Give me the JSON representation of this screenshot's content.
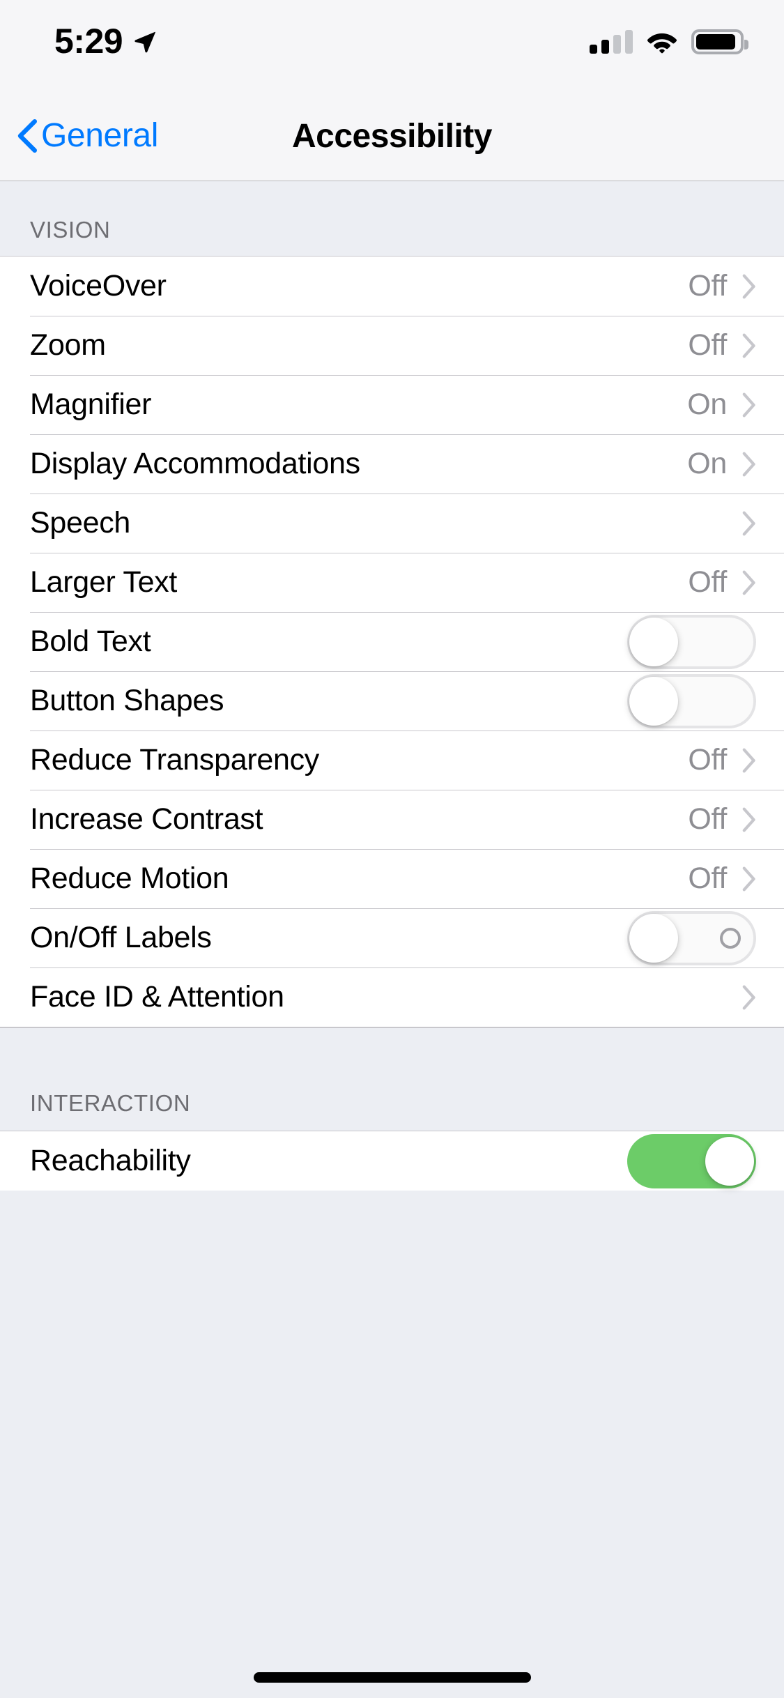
{
  "status_bar": {
    "time": "5:29",
    "location_icon": "location-arrow-icon",
    "cellular_icon": "cellular-signal-icon",
    "cellular_bars_filled": 2,
    "cellular_bars_total": 4,
    "wifi_icon": "wifi-icon",
    "battery_icon": "battery-icon",
    "battery_level_percent": 84
  },
  "nav": {
    "back_label": "General",
    "back_icon": "chevron-left-icon",
    "title": "Accessibility"
  },
  "colors": {
    "accent_blue": "#007aff",
    "switch_on_green": "#6ccc68",
    "value_gray": "#8e8e93",
    "header_gray": "#6d6d72",
    "group_background": "#eceef3",
    "row_background": "#ffffff",
    "separator": "#c8c7cc"
  },
  "sections": [
    {
      "header": "VISION",
      "rows": [
        {
          "label": "VoiceOver",
          "value": "Off",
          "accessory": "chevron"
        },
        {
          "label": "Zoom",
          "value": "Off",
          "accessory": "chevron"
        },
        {
          "label": "Magnifier",
          "value": "On",
          "accessory": "chevron"
        },
        {
          "label": "Display Accommodations",
          "value": "On",
          "accessory": "chevron"
        },
        {
          "label": "Speech",
          "value": "",
          "accessory": "chevron"
        },
        {
          "label": "Larger Text",
          "value": "Off",
          "accessory": "chevron"
        },
        {
          "label": "Bold Text",
          "value": "",
          "accessory": "switch",
          "switch_on": false,
          "switch_labels": false
        },
        {
          "label": "Button Shapes",
          "value": "",
          "accessory": "switch",
          "switch_on": false,
          "switch_labels": false
        },
        {
          "label": "Reduce Transparency",
          "value": "Off",
          "accessory": "chevron"
        },
        {
          "label": "Increase Contrast",
          "value": "Off",
          "accessory": "chevron"
        },
        {
          "label": "Reduce Motion",
          "value": "Off",
          "accessory": "chevron"
        },
        {
          "label": "On/Off Labels",
          "value": "",
          "accessory": "switch",
          "switch_on": false,
          "switch_labels": true
        },
        {
          "label": "Face ID & Attention",
          "value": "",
          "accessory": "chevron"
        }
      ]
    },
    {
      "header": "INTERACTION",
      "rows": [
        {
          "label": "Reachability",
          "value": "",
          "accessory": "switch",
          "switch_on": true,
          "switch_labels": false
        }
      ]
    }
  ]
}
